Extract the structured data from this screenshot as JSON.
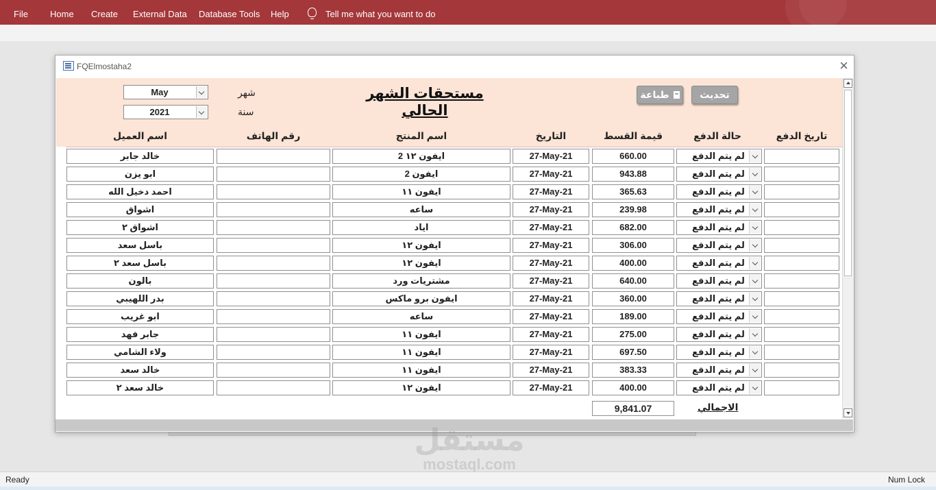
{
  "ribbon": {
    "tabs": [
      "File",
      "Home",
      "Create",
      "External Data",
      "Database Tools",
      "Help"
    ],
    "tell_me": "Tell me what you want to do",
    "bg_color": "#a4373a"
  },
  "form": {
    "window_title": "FQElmostaha2",
    "title": "مستحقات الشهر الحالي",
    "month_label": "شهر",
    "year_label": "سنة",
    "month_value": "May",
    "year_value": "2021",
    "refresh_button": "تحديث",
    "print_button": "طباعة",
    "header_bg": "#fce4d6",
    "columns": {
      "payment_date": "تاريخ الدفع",
      "payment_status": "حالة الدفع",
      "installment": "قيمة القسط",
      "date": "التاريخ",
      "product": "اسم المنتج",
      "phone": "رقم الهاتف",
      "customer": "اسم العميل"
    },
    "rows": [
      {
        "payment_date": "",
        "status": "لم يتم الدفع",
        "amount": "660.00",
        "date": "27-May-21",
        "product": "2 ايفون ١٢",
        "phone": "",
        "customer": "خالد جابر"
      },
      {
        "payment_date": "",
        "status": "لم يتم الدفع",
        "amount": "943.88",
        "date": "27-May-21",
        "product": "2 ايفون",
        "phone": "",
        "customer": "ابو يزن"
      },
      {
        "payment_date": "",
        "status": "لم يتم الدفع",
        "amount": "365.63",
        "date": "27-May-21",
        "product": "ايفون ١١",
        "phone": "",
        "customer": "احمد دخيل الله"
      },
      {
        "payment_date": "",
        "status": "لم يتم الدفع",
        "amount": "239.98",
        "date": "27-May-21",
        "product": "ساعه",
        "phone": "",
        "customer": "اشواق"
      },
      {
        "payment_date": "",
        "status": "لم يتم الدفع",
        "amount": "682.00",
        "date": "27-May-21",
        "product": "اياد",
        "phone": "",
        "customer": "اشواق ٢"
      },
      {
        "payment_date": "",
        "status": "لم يتم الدفع",
        "amount": "306.00",
        "date": "27-May-21",
        "product": "ايفون ١٢",
        "phone": "",
        "customer": "باسل سعد"
      },
      {
        "payment_date": "",
        "status": "لم يتم الدفع",
        "amount": "400.00",
        "date": "27-May-21",
        "product": "ايفون ١٢",
        "phone": "",
        "customer": "باسل سعد ٢"
      },
      {
        "payment_date": "",
        "status": "لم يتم الدفع",
        "amount": "640.00",
        "date": "27-May-21",
        "product": "مشتريات ورد",
        "phone": "",
        "customer": "بالون"
      },
      {
        "payment_date": "",
        "status": "لم يتم الدفع",
        "amount": "360.00",
        "date": "27-May-21",
        "product": "ايفون برو ماكس",
        "phone": "",
        "customer": "بدر اللهيبي"
      },
      {
        "payment_date": "",
        "status": "لم يتم الدفع",
        "amount": "189.00",
        "date": "27-May-21",
        "product": "ساعه",
        "phone": "",
        "customer": "ابو غريب"
      },
      {
        "payment_date": "",
        "status": "لم يتم الدفع",
        "amount": "275.00",
        "date": "27-May-21",
        "product": "ايفون ١١",
        "phone": "",
        "customer": "جابر فهد"
      },
      {
        "payment_date": "",
        "status": "لم يتم الدفع",
        "amount": "697.50",
        "date": "27-May-21",
        "product": "ايفون ١١",
        "phone": "",
        "customer": "ولاء الشامي"
      },
      {
        "payment_date": "",
        "status": "لم يتم الدفع",
        "amount": "383.33",
        "date": "27-May-21",
        "product": "ايفون ١١",
        "phone": "",
        "customer": "خالد سعد"
      },
      {
        "payment_date": "",
        "status": "لم يتم الدفع",
        "amount": "400.00",
        "date": "27-May-21",
        "product": "ايفون ١٢",
        "phone": "",
        "customer": "خالد سعد ٢"
      }
    ],
    "total_label": "الاجمالي",
    "total_value": "9,841.07"
  },
  "watermark": {
    "arabic": "مستقل",
    "latin": "mostaql.com"
  },
  "status_bar": {
    "left": "Ready",
    "right": "Num Lock"
  }
}
